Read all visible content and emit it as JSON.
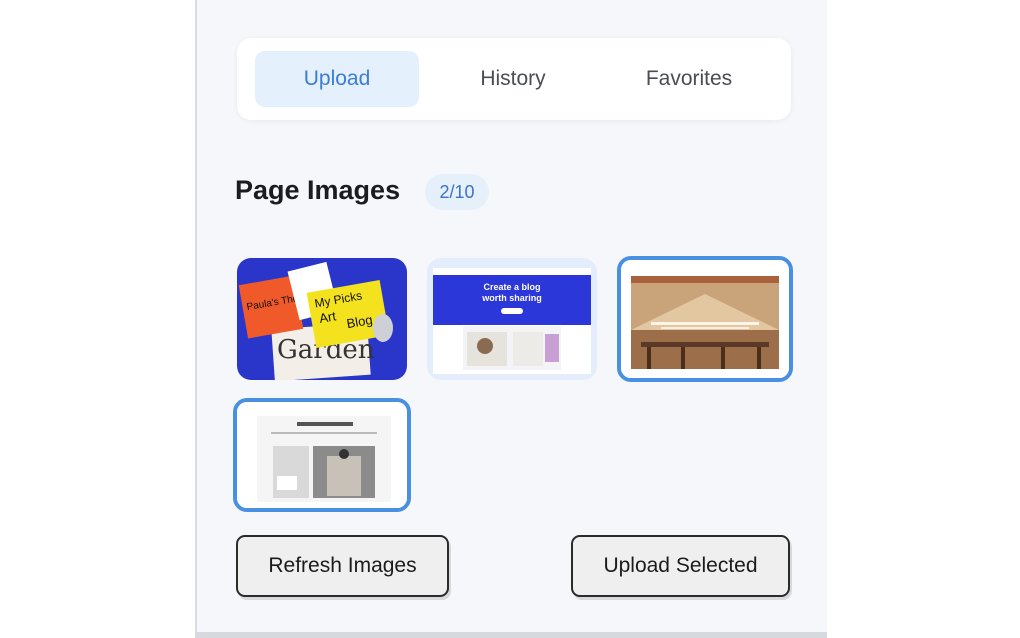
{
  "tabs": [
    {
      "label": "Upload",
      "active": true
    },
    {
      "label": "History",
      "active": false
    },
    {
      "label": "Favorites",
      "active": false
    }
  ],
  "section": {
    "title": "Page Images",
    "count": "2/10"
  },
  "images": [
    {
      "name": "art-blog",
      "selected": false,
      "text": [
        "Paula's Thoughts",
        "My Picks",
        "Art",
        "Blog",
        "Garden"
      ]
    },
    {
      "name": "create-a-blog",
      "selected": false,
      "text": [
        "Create a blog",
        "worth sharing"
      ]
    },
    {
      "name": "tent-resort",
      "selected": true
    },
    {
      "name": "interior-blog",
      "selected": true
    }
  ],
  "buttons": {
    "refresh": "Refresh Images",
    "upload_selected": "Upload Selected"
  },
  "colors": {
    "accent": "#4a90e2",
    "active_tab_bg": "#e4f0fc",
    "active_tab_text": "#3b7dd6",
    "panel_bg": "#f6f7fa"
  }
}
